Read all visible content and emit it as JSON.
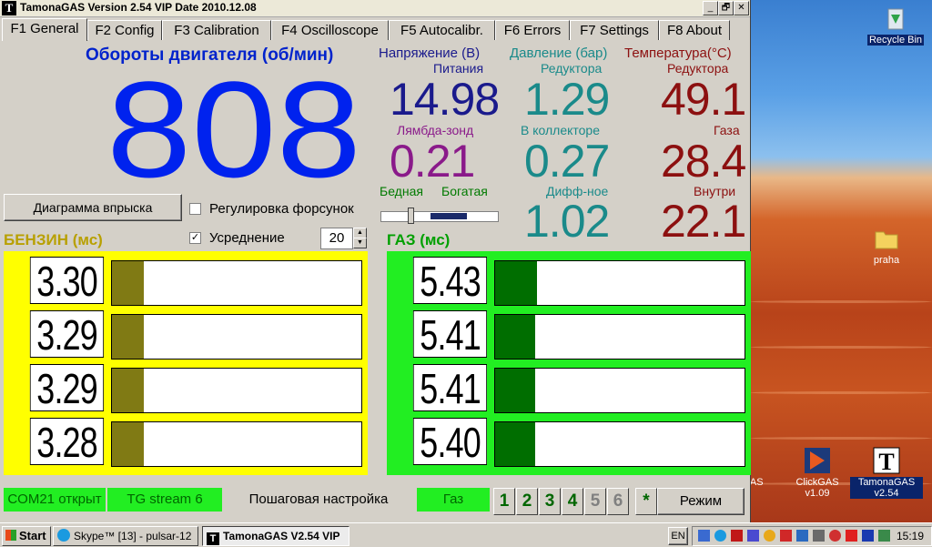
{
  "window": {
    "title": "TamonaGAS  Version 2.54 VIP  Date 2010.12.08",
    "title_buttons": [
      "_",
      "🗗",
      "✕"
    ]
  },
  "tabs": [
    {
      "label": "F1 General",
      "active": true
    },
    {
      "label": "F2 Config"
    },
    {
      "label": "F3 Calibration"
    },
    {
      "label": "F4 Oscilloscope"
    },
    {
      "label": "F5 Autocalibr."
    },
    {
      "label": "F6 Errors"
    },
    {
      "label": "F7 Settings"
    },
    {
      "label": "F8 About"
    }
  ],
  "rpm": {
    "title": "Обороты двигателя (об/мин)",
    "value": "808",
    "color": "#0022ee"
  },
  "voltage": {
    "header": "Напряжение (В)",
    "label": "Питания",
    "value": "14.98",
    "color": "#1a1a8c"
  },
  "lambda": {
    "label": "Лямбда-зонд",
    "value": "0.21",
    "color": "#8a1a8a",
    "lean_label": "Бедная",
    "rich_label": "Богатая"
  },
  "pressure": {
    "header": "Давление (бар)",
    "reducer_label": "Редуктора",
    "reducer_value": "1.29",
    "manifold_label": "В коллекторе",
    "manifold_value": "0.27",
    "diff_label": "Дифф-ное",
    "diff_value": "1.02",
    "color": "#1a8a8a"
  },
  "temperature": {
    "header": "Температура(°С)",
    "reducer_label": "Редуктора",
    "reducer_value": "49.1",
    "gas_label": "Газа",
    "gas_value": "28.4",
    "inside_label": "Внутри",
    "inside_value": "22.1",
    "color": "#8c1010"
  },
  "controls": {
    "diagram_button": "Диаграмма впрыска",
    "injector_adjust_label": "Регулировка форсунок",
    "injector_adjust_checked": false,
    "averaging_label": "Усреднение",
    "averaging_checked": true,
    "averaging_value": "20",
    "check_mark": "✓",
    "spin_up": "▲",
    "spin_down": "▼"
  },
  "petrol": {
    "title": "БЕНЗИН (мс)",
    "color": "#b8b000",
    "bg": "#ffff00",
    "fill_color": "#807a14",
    "values": [
      "3.30",
      "3.29",
      "3.29",
      "3.28"
    ],
    "fill_fraction": [
      0.13,
      0.13,
      0.13,
      0.13
    ]
  },
  "gas": {
    "title": "ГАЗ (мс)",
    "color": "#00a000",
    "bg": "#22ee22",
    "fill_color": "#006e00",
    "values": [
      "5.43",
      "5.41",
      "5.41",
      "5.40"
    ],
    "fill_fraction": [
      0.17,
      0.16,
      0.16,
      0.16
    ]
  },
  "status": {
    "port": "COM21 открыт",
    "stream": "TG stream 6",
    "step_setup": "Пошаговая настройка",
    "fuel": "Газ",
    "steps": [
      "1",
      "2",
      "3",
      "4",
      "5",
      "6"
    ],
    "star": "*",
    "mode_button": "Режим"
  },
  "desktop": {
    "icons": [
      {
        "label": "Recycle Bin",
        "icon": "recycle-bin-icon"
      },
      {
        "label": "praha",
        "icon": "folder-icon"
      },
      {
        "label": "GAS",
        "icon": "app-icon"
      },
      {
        "label": "ClickGAS v1.09",
        "icon": "clickgas-icon"
      },
      {
        "label": "TamonaGAS v2.54",
        "icon": "tamonagas-icon"
      }
    ]
  },
  "taskbar": {
    "start": "Start",
    "tasks": [
      {
        "label": "Skype™ [13] - pulsar-12"
      },
      {
        "label": "TamonaGAS  V2.54 VIP",
        "active": true
      }
    ],
    "lang": "EN",
    "clock": "15:19"
  }
}
